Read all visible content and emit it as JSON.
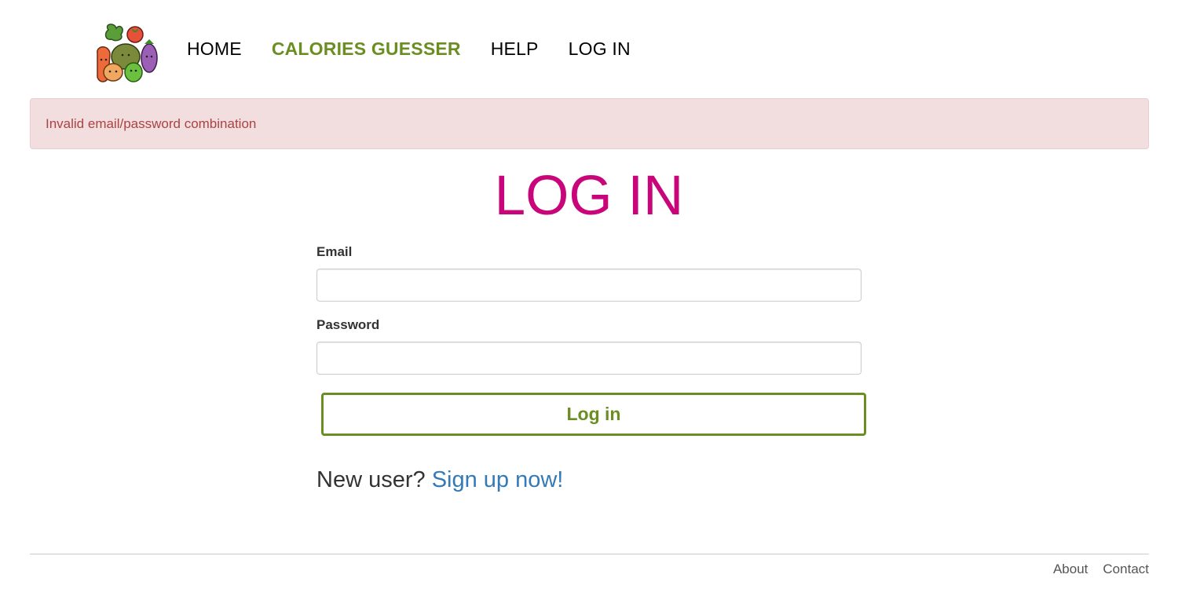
{
  "nav": {
    "home": "HOME",
    "calories_guesser": "CALORIES GUESSER",
    "help": "HELP",
    "log_in": "LOG IN",
    "active_color": "#6b8e23"
  },
  "alert": {
    "message": "Invalid email/password combination",
    "bg_color": "#f2dede",
    "text_color": "#a94442"
  },
  "page": {
    "title": "LOG IN",
    "title_color": "#c8067a"
  },
  "form": {
    "email_label": "Email",
    "email_value": "",
    "password_label": "Password",
    "password_value": "",
    "submit_label": "Log in"
  },
  "signup": {
    "prompt": "New user?",
    "link": "Sign up now!"
  },
  "footer": {
    "about": "About",
    "contact": "Contact"
  },
  "icons": {
    "logo": "vegetables-logo-icon"
  }
}
